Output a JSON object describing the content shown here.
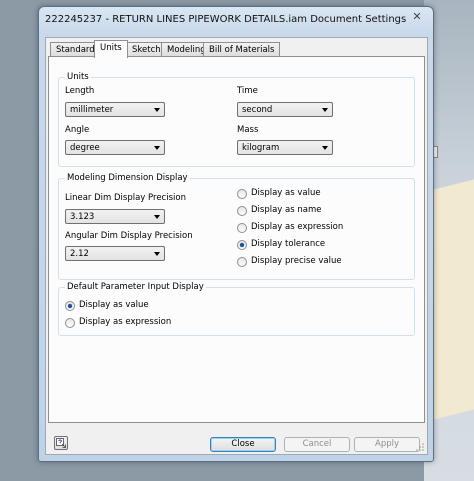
{
  "window": {
    "title": "222245237 - RETURN LINES PIPEWORK DETAILS.iam Document Settings",
    "close_glyph": "✕"
  },
  "tabs": [
    {
      "label": "Standard"
    },
    {
      "label": "Units",
      "active": true
    },
    {
      "label": "Sketch"
    },
    {
      "label": "Modeling"
    },
    {
      "label": "Bill of Materials"
    }
  ],
  "units": {
    "group_title": "Units",
    "length_label": "Length",
    "length_value": "millimeter",
    "time_label": "Time",
    "time_value": "second",
    "angle_label": "Angle",
    "angle_value": "degree",
    "mass_label": "Mass",
    "mass_value": "kilogram"
  },
  "modeling_display": {
    "group_title": "Modeling Dimension Display",
    "linear_label": "Linear Dim Display Precision",
    "linear_value": "3.123",
    "angular_label": "Angular Dim Display Precision",
    "angular_value": "2.12",
    "options": [
      {
        "label": "Display as value",
        "selected": false
      },
      {
        "label": "Display as name",
        "selected": false
      },
      {
        "label": "Display as expression",
        "selected": false
      },
      {
        "label": "Display tolerance",
        "selected": true
      },
      {
        "label": "Display precise value",
        "selected": false
      }
    ]
  },
  "param_input": {
    "group_title": "Default Parameter Input Display",
    "options": [
      {
        "label": "Display as value",
        "selected": true
      },
      {
        "label": "Display as expression",
        "selected": false
      }
    ]
  },
  "buttons": {
    "close": "Close",
    "cancel": "Cancel",
    "apply": "Apply"
  },
  "icons": {
    "help": "help-icon",
    "resize": "resize-grip-icon",
    "dropdown": "chevron-down-icon"
  },
  "colors": {
    "radio_selected": "#1e4f96",
    "window_frame": "#c0d2e6",
    "disabled_text": "#8d8d8d"
  }
}
